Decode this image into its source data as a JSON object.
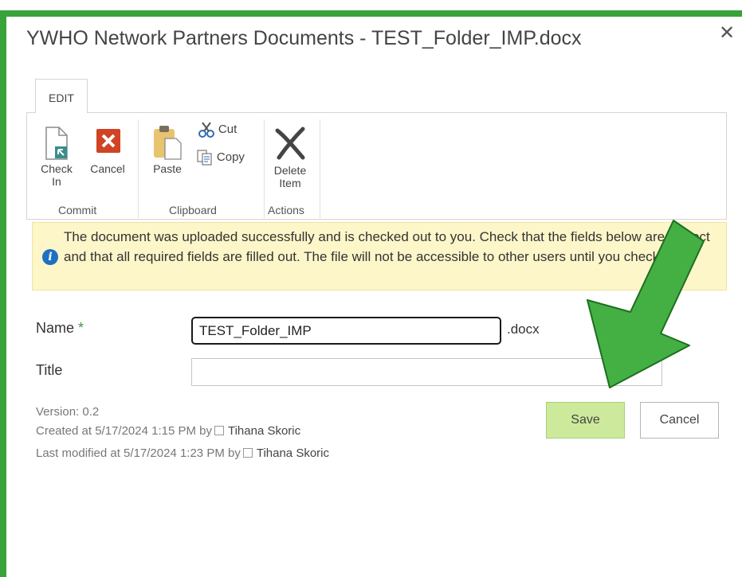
{
  "dialog": {
    "title": "YWHO Network Partners Documents - TEST_Folder_IMP.docx",
    "close_glyph": "✕"
  },
  "ribbon": {
    "tab_label": "EDIT",
    "buttons": {
      "check_in": "Check In",
      "cancel": "Cancel",
      "paste": "Paste",
      "cut": "Cut",
      "copy": "Copy",
      "delete_item": "Delete Item"
    },
    "groups": {
      "commit": "Commit",
      "clipboard": "Clipboard",
      "actions": "Actions"
    }
  },
  "message": {
    "text": "The document was uploaded successfully and is checked out to you. Check that the fields below are correct and that all required fields are filled out. The file will not be accessible to other users until you check in."
  },
  "form": {
    "name_label": "Name",
    "required_mark": "*",
    "name_value": "TEST_Folder_IMP",
    "extension": ".docx",
    "title_label": "Title",
    "title_value": ""
  },
  "metadata": {
    "version": "Version: 0.2",
    "created_prefix": "Created at 5/17/2024 1:15 PM  by",
    "created_by": "Tihana Skoric",
    "modified_prefix": "Last modified at 5/17/2024 1:23 PM  by",
    "modified_by": "Tihana Skoric"
  },
  "actions": {
    "save": "Save",
    "cancel": "Cancel"
  },
  "colors": {
    "frame": "#3aa23a",
    "arrow": "#44b044",
    "save_button": "#cde99b",
    "info_icon": "#1e70c2",
    "message_bg": "#fdf6c9"
  }
}
